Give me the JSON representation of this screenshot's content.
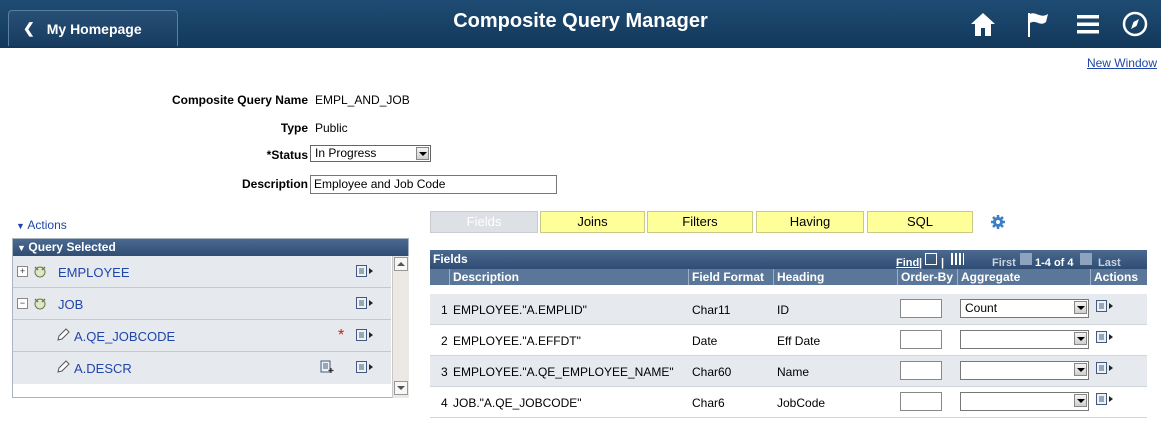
{
  "header": {
    "home_label": "My Homepage",
    "title": "Composite Query Manager",
    "icons": [
      "home-icon",
      "flag-icon",
      "menu-icon",
      "compass-icon"
    ]
  },
  "new_window": "New Window",
  "form": {
    "name_label": "Composite Query Name",
    "name_value": "EMPL_AND_JOB",
    "type_label": "Type",
    "type_value": "Public",
    "status_label": "*Status",
    "status_value": "In Progress",
    "desc_label": "Description",
    "desc_value": "Employee and Job Code"
  },
  "actions_label": "Actions",
  "query_selected": {
    "title": "Query Selected",
    "items": [
      {
        "label": "EMPLOYEE",
        "kind": "query"
      },
      {
        "label": "JOB",
        "kind": "query"
      },
      {
        "label": "A.QE_JOBCODE",
        "kind": "field",
        "required": "*"
      },
      {
        "label": "A.DESCR",
        "kind": "field"
      }
    ]
  },
  "tabs": [
    "Fields",
    "Joins",
    "Filters",
    "Having",
    "SQL"
  ],
  "grid": {
    "title": "Fields",
    "find": "Find",
    "nav_first": "First",
    "nav_range": "1-4 of 4",
    "nav_last": "Last",
    "columns": [
      "Description",
      "Field Format",
      "Heading",
      "Order-By",
      "Aggregate",
      "Actions"
    ],
    "rows": [
      {
        "num": "1",
        "description": "EMPLOYEE.\"A.EMPLID\"",
        "format": "Char11",
        "heading": "ID",
        "aggregate": "Count"
      },
      {
        "num": "2",
        "description": "EMPLOYEE.\"A.EFFDT\"",
        "format": "Date",
        "heading": "Eff Date",
        "aggregate": ""
      },
      {
        "num": "3",
        "description": "EMPLOYEE.\"A.QE_EMPLOYEE_NAME\"",
        "format": "Char60",
        "heading": "Name",
        "aggregate": ""
      },
      {
        "num": "4",
        "description": "JOB.\"A.QE_JOBCODE\"",
        "format": "Char6",
        "heading": "JobCode",
        "aggregate": ""
      }
    ]
  }
}
